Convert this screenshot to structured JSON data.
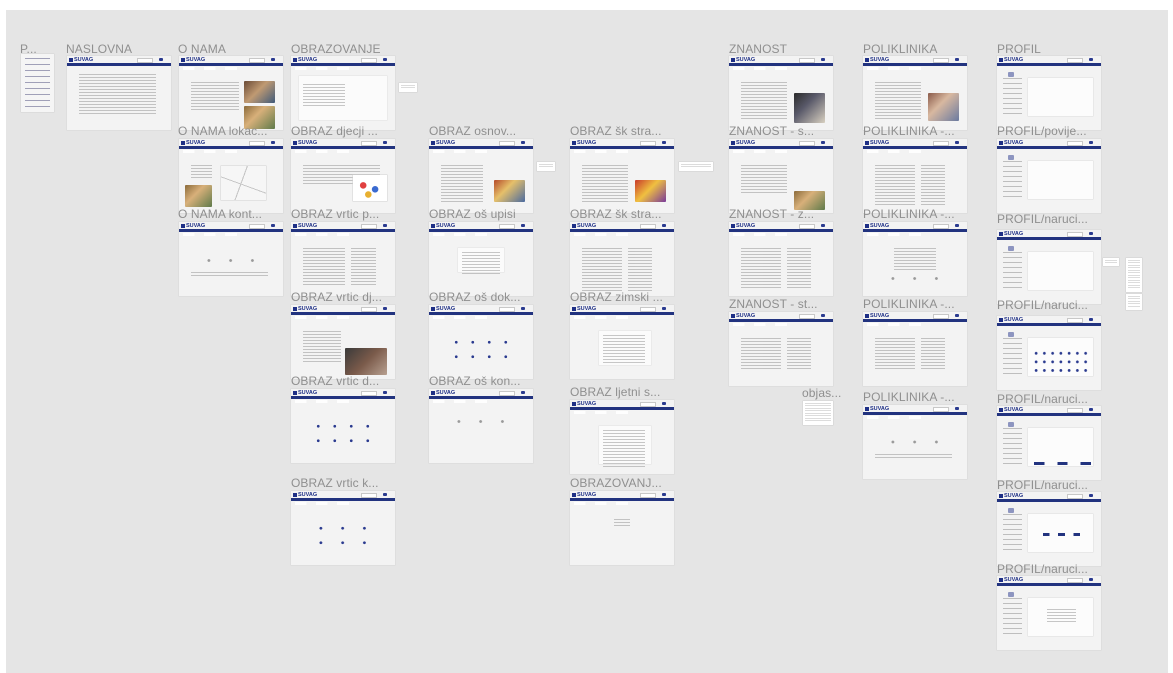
{
  "frame_labels": {
    "pages": "P...",
    "naslovna": "NASLOVNA",
    "o_nama": "O NAMA",
    "o_nama_lokac": "O NAMA lokac...",
    "o_nama_kont": "O NAMA kont...",
    "obrazovanje": "OBRAZOVANJE",
    "obraz_djecji": "OBRAZ djecji ...",
    "obraz_vrtic_p": "OBRAZ vrtic p...",
    "obraz_vrtic_dj": "OBRAZ vrtic dj...",
    "obraz_vrtic_d": "OBRAZ vrtic d...",
    "obraz_vrtic_k": "OBRAZ vrtic k...",
    "obraz_osnov": "OBRAZ osnov...",
    "obraz_os_upisi": "OBRAZ oš upisi",
    "obraz_os_dok": "OBRAZ oš dok...",
    "obraz_os_kon": "OBRAZ oš kon...",
    "obraz_sk_stra_1": "OBRAZ šk stra...",
    "obraz_sk_stra_2": "OBRAZ šk stra...",
    "obraz_zimski": "OBRAZ zimski ...",
    "obraz_ljetni": "OBRAZ ljetni s...",
    "obrazovanj": "OBRAZOVANJ...",
    "znanost": "ZNANOST",
    "znanost_s": "ZNANOST - s...",
    "znanost_z": "ZNANOST - z...",
    "znanost_st": "ZNANOST - st...",
    "objas": "objas...",
    "poliklinika": "POLIKLINIKA",
    "poliklinika_1": "POLIKLINIKA -...",
    "poliklinika_2": "POLIKLINIKA -...",
    "poliklinika_3": "POLIKLINIKA -...",
    "poliklinika_4": "POLIKLINIKA -...",
    "profil": "PROFIL",
    "profil_povije": "PROFIL/povije...",
    "profil_naruci_1": "PROFIL/naruci...",
    "profil_naruci_2": "PROFIL/naruci...",
    "profil_naruci_3": "PROFIL/naruci...",
    "profil_naruci_4": "PROFIL/naruci...",
    "profil_naruci_5": "PROFIL/naruci..."
  },
  "brand": "SUVAG",
  "colors": {
    "canvas_bg": "#e5e5e5",
    "frame_bg": "#f3f3f3",
    "nav_blue": "#22337f",
    "label_gray": "#8f8f8f"
  }
}
